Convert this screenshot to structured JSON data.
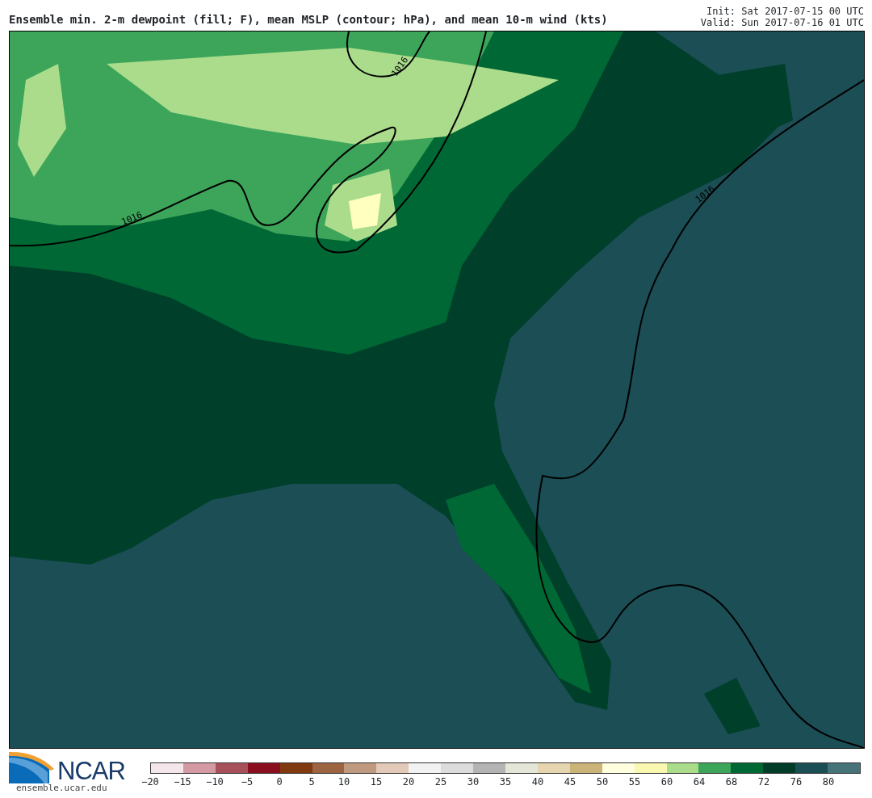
{
  "title": "Ensemble min. 2-m dewpoint (fill; F), mean MSLP (contour; hPa), and mean 10-m wind (kts)",
  "init": "Init: Sat 2017-07-15 00 UTC",
  "valid": "Valid: Sun 2017-07-16 01 UTC",
  "map": {
    "contour_labels": [
      "1016",
      "1016",
      "1016"
    ]
  },
  "logo": {
    "text": "NCAR",
    "url": "ensemble.ucar.edu"
  },
  "colorbar": {
    "segments": [
      {
        "color": "#f5e6ec"
      },
      {
        "color": "#d49aa4"
      },
      {
        "color": "#a8505a"
      },
      {
        "color": "#8a0f1e"
      },
      {
        "color": "#7f3a0f"
      },
      {
        "color": "#9c6440"
      },
      {
        "color": "#c09a80"
      },
      {
        "color": "#e2c9b8"
      },
      {
        "color": "#f2f2f2"
      },
      {
        "color": "#dcdcdc"
      },
      {
        "color": "#b4b4b4"
      },
      {
        "color": "#e4e6d8"
      },
      {
        "color": "#e6d6b0"
      },
      {
        "color": "#cab478"
      },
      {
        "color": "#ffffe0"
      },
      {
        "color": "#f8f8b0"
      },
      {
        "color": "#aadc8c"
      },
      {
        "color": "#3ca55a"
      },
      {
        "color": "#006834"
      },
      {
        "color": "#003c28"
      },
      {
        "color": "#1b4e55"
      },
      {
        "color": "#467378"
      }
    ],
    "ticks": [
      "−20",
      "−15",
      "−10",
      "−5",
      "0",
      "5",
      "10",
      "15",
      "20",
      "25",
      "30",
      "35",
      "40",
      "45",
      "50",
      "55",
      "60",
      "64",
      "68",
      "72",
      "76",
      "80"
    ]
  }
}
